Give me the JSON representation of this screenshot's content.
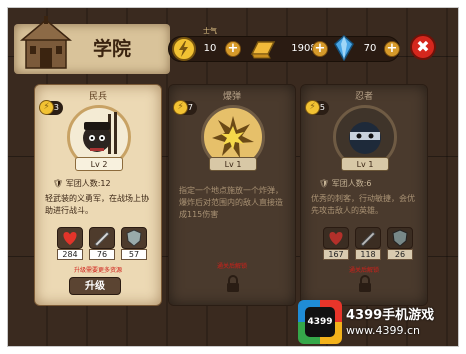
{
  "header": {
    "title": "学院",
    "stamina_label": "士气",
    "resources": [
      {
        "name": "energy",
        "icon": "lightning-icon",
        "value": "10",
        "color": "#f2c233"
      },
      {
        "name": "gold",
        "icon": "gold-bar-icon",
        "value": "1908",
        "color": "#f0b93a"
      },
      {
        "name": "crystal",
        "icon": "crystal-icon",
        "value": "70",
        "color": "#4aa6e6"
      }
    ],
    "plus_label": "+",
    "close_label": "✖"
  },
  "cards": [
    {
      "name": "民兵",
      "cost": "3",
      "level": "Lv 2",
      "corps": "军团人数:12",
      "desc": "轻武装的义勇军，在战场上协助进行战斗。",
      "stats": [
        "284",
        "76",
        "57"
      ],
      "warning": "升级需要更多资源",
      "button": "升级",
      "locked": false
    },
    {
      "name": "爆弹",
      "cost": "7",
      "level": "Lv 1",
      "corps": "",
      "desc": "指定一个地点施放一个炸弹，爆炸后对范围内的敌人直接造成115伤害",
      "warning": "通关后解锁",
      "locked": true
    },
    {
      "name": "忍者",
      "cost": "5",
      "level": "Lv 1",
      "corps": "军团人数:6",
      "desc": "优秀的刺客，行动敏捷，会优先攻击敌人的英雄。",
      "stats": [
        "167",
        "118",
        "26"
      ],
      "warning": "通关后解锁",
      "locked": true
    }
  ],
  "watermark": {
    "logo_text": "4399",
    "brand": "4399手机游戏",
    "url": "www.4399.cn"
  }
}
